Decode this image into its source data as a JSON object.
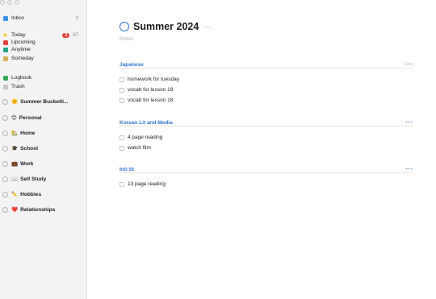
{
  "sidebar": {
    "inbox": {
      "label": "Inbox",
      "count": "9",
      "icon": "inbox-icon",
      "color": "#3b8ee8"
    },
    "today": {
      "label": "Today",
      "badge": "3",
      "count": "67",
      "icon": "star-icon",
      "color": "#f5c518"
    },
    "upcoming": {
      "label": "Upcoming",
      "icon": "calendar-icon",
      "color": "#e0443c"
    },
    "anytime": {
      "label": "Anytime",
      "icon": "layers-icon",
      "color": "#27a085"
    },
    "someday": {
      "label": "Someday",
      "icon": "archive-box-icon",
      "color": "#d8b25a"
    },
    "logbook": {
      "label": "Logbook",
      "icon": "logbook-icon",
      "color": "#3aa757"
    },
    "trash": {
      "label": "Trash",
      "icon": "trash-icon",
      "color": "#9a9aa0"
    },
    "projects": [
      {
        "emoji": "🌞",
        "label": "Summer Bucketli..."
      },
      {
        "emoji": "😊",
        "label": "Personal"
      },
      {
        "emoji": "🏡",
        "label": "Home"
      },
      {
        "emoji": "🎓",
        "label": "School"
      },
      {
        "emoji": "💼",
        "label": "Work"
      },
      {
        "emoji": "📖",
        "label": "Self Study"
      },
      {
        "emoji": "✏️",
        "label": "Hobbies"
      },
      {
        "emoji": "❤️",
        "label": "Relationships"
      }
    ]
  },
  "main": {
    "title": "Summer 2024",
    "title_more": "···",
    "notes_placeholder": "Notes",
    "accent": "#2f76d2",
    "sections": [
      {
        "heading": "Japanese",
        "more": "···",
        "tasks": [
          "homework for tuesday",
          "vocab for lesson 19",
          "vocab for lesson 18"
        ]
      },
      {
        "heading": "Korean Lit and Media",
        "more": "···",
        "tasks": [
          "4 page reading",
          "watch film"
        ]
      },
      {
        "heading": "Intl St",
        "more": "···",
        "tasks": [
          "13 page reading"
        ]
      }
    ]
  }
}
